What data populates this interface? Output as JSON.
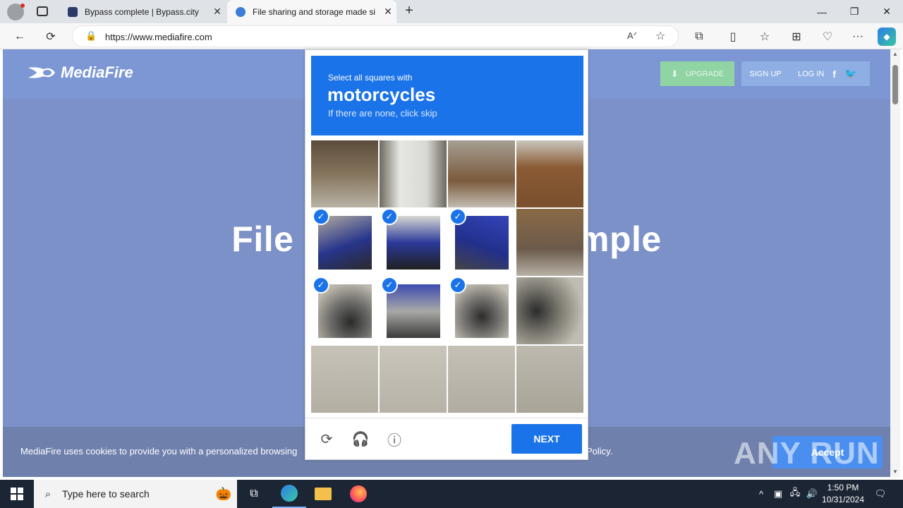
{
  "browser": {
    "tabs": [
      {
        "title": "Bypass complete | Bypass.city",
        "active": false
      },
      {
        "title": "File sharing and storage made si",
        "active": true
      }
    ],
    "new_tab": "+",
    "url": "https://www.mediafire.com",
    "window_controls": {
      "minimize": "—",
      "restore": "❐",
      "close": "✕"
    }
  },
  "page": {
    "logo_text": "MediaFire",
    "header_buttons": {
      "upgrade": "UPGRADE",
      "signup": "SIGN UP",
      "login": "LOG IN"
    },
    "hero_text": "File storage made simple",
    "cookie_text": "MediaFire uses cookies to provide you with a personalized browsing",
    "cookie_text_tail": "Policy.",
    "accept_label": "Accept",
    "watermark": "ANY RUN"
  },
  "captcha": {
    "instruction": "Select all squares with",
    "target": "motorcycles",
    "hint": "If there are none, click skip",
    "next_label": "NEXT",
    "selected_cells": [
      4,
      5,
      6,
      8,
      9,
      10
    ]
  },
  "taskbar": {
    "search_placeholder": "Type here to search",
    "time": "1:50 PM",
    "date": "10/31/2024"
  },
  "colors": {
    "captcha_blue": "#1a73e8",
    "page_bg": "#7b91c8",
    "taskbar": "#1c2533"
  }
}
